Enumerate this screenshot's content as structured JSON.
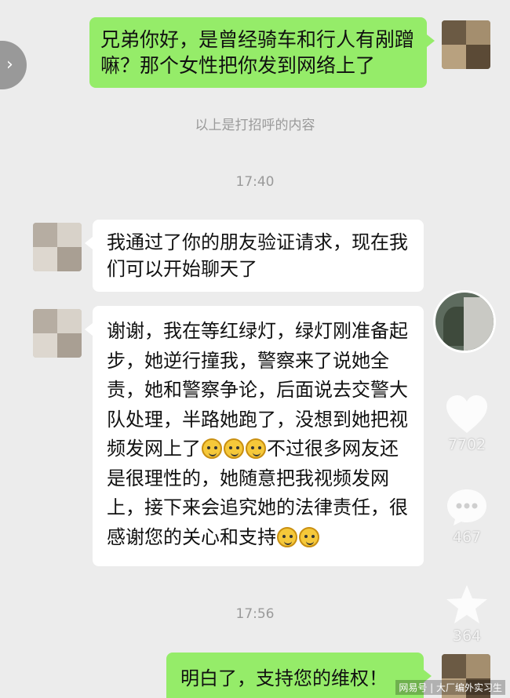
{
  "messages": {
    "m1": "兄弟你好，是曾经骑车和行人有剐蹭嘛？那个女性把你发到网络上了",
    "m1_hint": "以上是打招呼的内容",
    "time1": "17:40",
    "m2": "我通过了你的朋友验证请求，现在我们可以开始聊天了",
    "m3_part1": "谢谢，我在等红绿灯，绿灯刚准备起步，她逆行撞我，警察来了说她全责，她和警察争论，后面说去交警大队处理，半路她跑了，没想到她把视频发网上了",
    "m3_part2": "不过很多网友还是很理性的，她随意把我视频发网上，接下来会追究她的法律责任，很感谢您的关心和支持",
    "time2": "17:56",
    "m4": "明白了，支持您的维权！"
  },
  "rail": {
    "likes": "7702",
    "comments": "467",
    "favorites": "364"
  },
  "watermark": "网易号 | 大厂编外实习生",
  "icons": {
    "side": "chevron-right-icon",
    "like": "heart-icon",
    "comment": "comment-icon",
    "favorite": "star-icon"
  },
  "colors": {
    "green_bubble": "#95ec69",
    "white_bubble": "#ffffff",
    "background": "#ececec"
  }
}
